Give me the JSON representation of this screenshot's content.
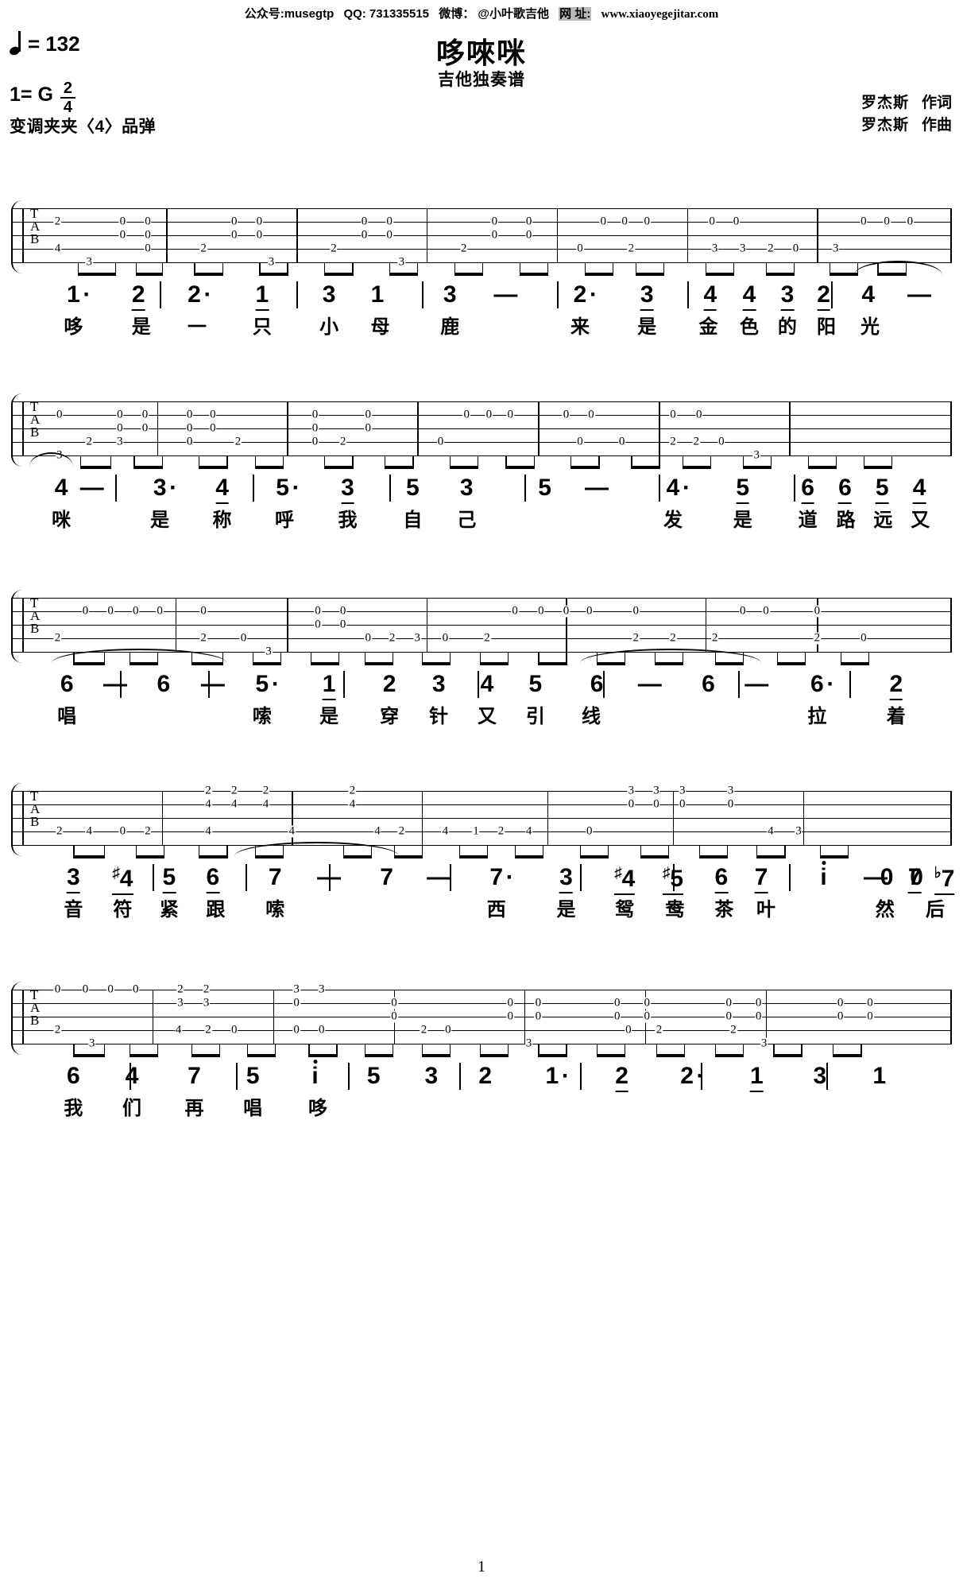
{
  "header": {
    "wechat": "公众号:musegtp",
    "qq": "QQ: 731335515",
    "weibo": "微博： @小叶歌吉他",
    "site_label": "网 址:",
    "site_url": "www.xiaoyegejitar.com"
  },
  "meta": {
    "tempo_value": "132",
    "tempo_eq": "=",
    "key_label": "1= G",
    "time_num": "2",
    "time_den": "4",
    "capo": "变调夹夹〈4〉品弹",
    "title": "哆唻咪",
    "subtitle": "吉他独奏谱",
    "lyricist_name": "罗杰斯",
    "lyricist_role": "作词",
    "composer_name": "罗杰斯",
    "composer_role": "作曲",
    "page_number": "1"
  },
  "tab_clef": [
    "T",
    "A",
    "B"
  ],
  "chart_data": {
    "type": "table",
    "title": "哆唻咪 吉他独奏谱",
    "systems": [
      {
        "id": "system-1",
        "melody": [
          "1·",
          "2",
          "2·",
          "1",
          "3",
          "1",
          "3",
          "—",
          "2·",
          "3",
          "4",
          "4",
          "3",
          "2",
          "4",
          "—"
        ],
        "lyrics": [
          "哆",
          "是",
          "一",
          "只",
          "小",
          "母",
          "鹿",
          "",
          "来",
          "是",
          "金",
          "色",
          "的",
          "阳",
          "光",
          ""
        ]
      },
      {
        "id": "system-2",
        "melody": [
          "4",
          "—",
          "3·",
          "4",
          "5·",
          "3",
          "5",
          "3",
          "5",
          "—",
          "4·",
          "5",
          "6",
          "6",
          "5",
          "4"
        ],
        "lyrics": [
          "咪",
          "",
          "是",
          "称",
          "呼",
          "我",
          "自",
          "己",
          "",
          "",
          "发",
          "是",
          "道",
          "路",
          "远",
          "又"
        ]
      },
      {
        "id": "system-3",
        "melody": [
          "6",
          "—",
          "6",
          "—",
          "5·",
          "1",
          "2",
          "3",
          "4",
          "5",
          "6",
          "—",
          "6",
          "—",
          "6·",
          "2"
        ],
        "lyrics": [
          "唱",
          "",
          "",
          "",
          "嗦",
          "是",
          "穿",
          "针",
          "又",
          "引",
          "线",
          "",
          "",
          "",
          "拉",
          "着"
        ]
      },
      {
        "id": "system-4",
        "melody": [
          "3",
          "♯4",
          "5",
          "6",
          "7",
          "—",
          "7",
          "—",
          "7·",
          "3",
          "♯4",
          "♯5",
          "6",
          "7",
          "i",
          "—",
          "0",
          "7",
          "♭7"
        ],
        "lyrics": [
          "音",
          "符",
          "紧",
          "跟",
          "嗦",
          "",
          "",
          "",
          "西",
          "是",
          "鸳",
          "鸯",
          "茶",
          "叶",
          "",
          "",
          "",
          "然",
          "后"
        ]
      },
      {
        "id": "system-5",
        "melody": [
          "6",
          "4",
          "7",
          "5",
          "i",
          "5",
          "3",
          "2",
          "1·",
          "2",
          "2·",
          "1",
          "3",
          "1"
        ],
        "lyrics": [
          "我",
          "们",
          "再",
          "唱",
          "哆",
          "",
          "",
          "",
          "",
          "",
          "",
          "",
          "",
          ""
        ]
      }
    ],
    "tab_systems": [
      {
        "id": "tab-system-1",
        "measures": [
          {
            "notes": [
              {
                "s": 4,
                "f": "3"
              },
              {
                "s": 2,
                "f": "0"
              },
              {
                "s": 2,
                "f": "0"
              },
              {
                "s": 4,
                "f": "0"
              }
            ]
          },
          {
            "notes": [
              {
                "s": 4,
                "f": "2"
              },
              {
                "s": 2,
                "f": "0"
              },
              {
                "s": 2,
                "f": "0"
              },
              {
                "s": 4,
                "f": "3"
              }
            ]
          },
          {
            "notes": [
              {
                "s": 4,
                "f": "2"
              },
              {
                "s": 2,
                "f": "0"
              },
              {
                "s": 2,
                "f": "0"
              },
              {
                "s": 4,
                "f": "3"
              }
            ]
          },
          {
            "notes": [
              {
                "s": 4,
                "f": "2"
              },
              {
                "s": 2,
                "f": "0"
              },
              {
                "s": 2,
                "f": "0"
              },
              {
                "s": 2,
                "f": "0"
              }
            ]
          },
          {
            "notes": [
              {
                "s": 4,
                "f": "0"
              },
              {
                "s": 2,
                "f": "0"
              },
              {
                "s": 2,
                "f": "0"
              },
              {
                "s": 4,
                "f": "2"
              }
            ]
          },
          {
            "notes": [
              {
                "s": 4,
                "f": "3"
              },
              {
                "s": 4,
                "f": "3"
              },
              {
                "s": 4,
                "f": "2"
              },
              {
                "s": 4,
                "f": "0"
              }
            ]
          },
          {
            "notes": [
              {
                "s": 4,
                "f": "3"
              },
              {
                "s": 2,
                "f": "0"
              },
              {
                "s": 2,
                "f": "0"
              },
              {
                "s": 2,
                "f": "0"
              }
            ]
          }
        ]
      }
    ]
  }
}
